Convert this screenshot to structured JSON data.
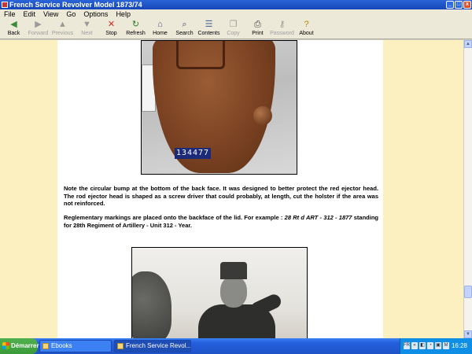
{
  "window": {
    "title": "French Service Revolver Model 1873/74"
  },
  "window_controls": {
    "minimize": "_",
    "maximize": "□",
    "close": "x"
  },
  "menu": [
    "File",
    "Edit",
    "View",
    "Go",
    "Options",
    "Help"
  ],
  "toolbar": [
    {
      "label": "Back",
      "icon": "◀",
      "icon_name": "back-arrow-icon",
      "enabled": true,
      "color": "#3a8a3a"
    },
    {
      "label": "Forward",
      "icon": "▶",
      "icon_name": "forward-arrow-icon",
      "enabled": false,
      "color": "#9a9a9a"
    },
    {
      "label": "Previous",
      "icon": "▲",
      "icon_name": "previous-arrow-icon",
      "enabled": false,
      "color": "#9a9a9a"
    },
    {
      "label": "Next",
      "icon": "▼",
      "icon_name": "next-arrow-icon",
      "enabled": false,
      "color": "#9a9a9a"
    },
    {
      "label": "Stop",
      "icon": "✕",
      "icon_name": "stop-icon",
      "enabled": true,
      "color": "#d42222"
    },
    {
      "label": "Refresh",
      "icon": "↻",
      "icon_name": "refresh-icon",
      "enabled": true,
      "color": "#2a7a2a"
    },
    {
      "label": "Home",
      "icon": "⌂",
      "icon_name": "home-icon",
      "enabled": true,
      "color": "#4a5a8a"
    },
    {
      "label": "Search",
      "icon": "⌕",
      "icon_name": "search-icon",
      "enabled": true,
      "color": "#4a4a6a"
    },
    {
      "label": "Contents",
      "icon": "☰",
      "icon_name": "contents-icon",
      "enabled": true,
      "color": "#4a6a9a"
    },
    {
      "label": "Copy",
      "icon": "❐",
      "icon_name": "copy-icon",
      "enabled": false,
      "color": "#9a9a9a"
    },
    {
      "label": "Print",
      "icon": "⎙",
      "icon_name": "print-icon",
      "enabled": true,
      "color": "#444444"
    },
    {
      "label": "Password",
      "icon": "⚷",
      "icon_name": "password-icon",
      "enabled": false,
      "color": "#9a9a9a"
    },
    {
      "label": "About",
      "icon": "?",
      "icon_name": "about-icon",
      "enabled": true,
      "color": "#b8860b"
    }
  ],
  "content": {
    "photo1_plate": "134477",
    "para1": "Note the circular bump at the bottom of the back face. It was designed to better protect the red ejector head. The rod ejector head is shaped as a screw driver that could probably, at length, cut the holster if the area was not reinforced.",
    "para2_before": "Reglementary markings are placed onto the backface of the lid. For example : ",
    "para2_marking": "28 Rt d ART - 312 - 1877",
    "para2_after": " standing for 28th Regiment of Artillery - Unit 312 - Year."
  },
  "scrollbar": {
    "up": "▲",
    "down": "▼",
    "thumb_position": 0.88
  },
  "taskbar": {
    "start": "Démarrer",
    "tasks": [
      {
        "label": "Ebooks",
        "active": false
      },
      {
        "label": "French Service Revol...",
        "active": true
      }
    ],
    "tray_icons": [
      "FR",
      "«",
      "◧",
      "◔",
      "▣",
      "M"
    ],
    "clock": "16:28"
  }
}
